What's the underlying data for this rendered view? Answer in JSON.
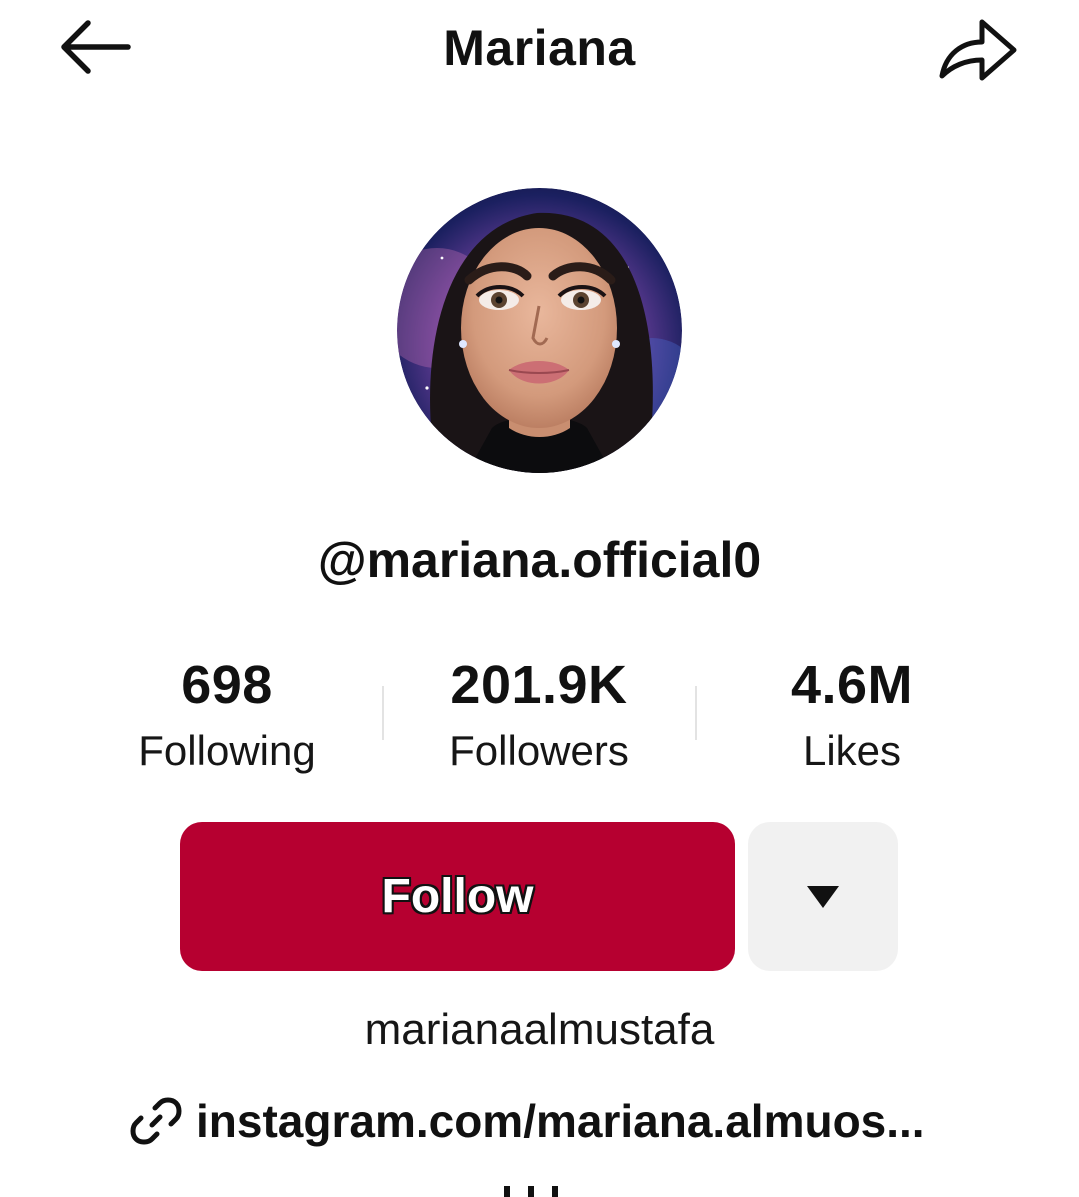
{
  "header": {
    "title": "Mariana",
    "back_icon": "arrow-left-icon",
    "share_icon": "share-arrow-icon"
  },
  "profile": {
    "username": "@mariana.official0",
    "avatar_icon": "profile-avatar"
  },
  "stats": [
    {
      "value": "698",
      "label": "Following"
    },
    {
      "value": "201.9K",
      "label": "Followers"
    },
    {
      "value": "4.6M",
      "label": "Likes"
    }
  ],
  "actions": {
    "follow_label": "Follow",
    "more_icon": "caret-down-icon"
  },
  "bio": {
    "text": "marianaalmustafa",
    "link_icon": "link-icon",
    "link": "instagram.com/mariana.almuos..."
  },
  "colors": {
    "accent": "#b60030",
    "secondary_button": "#f1f1f1",
    "text": "#111111"
  }
}
